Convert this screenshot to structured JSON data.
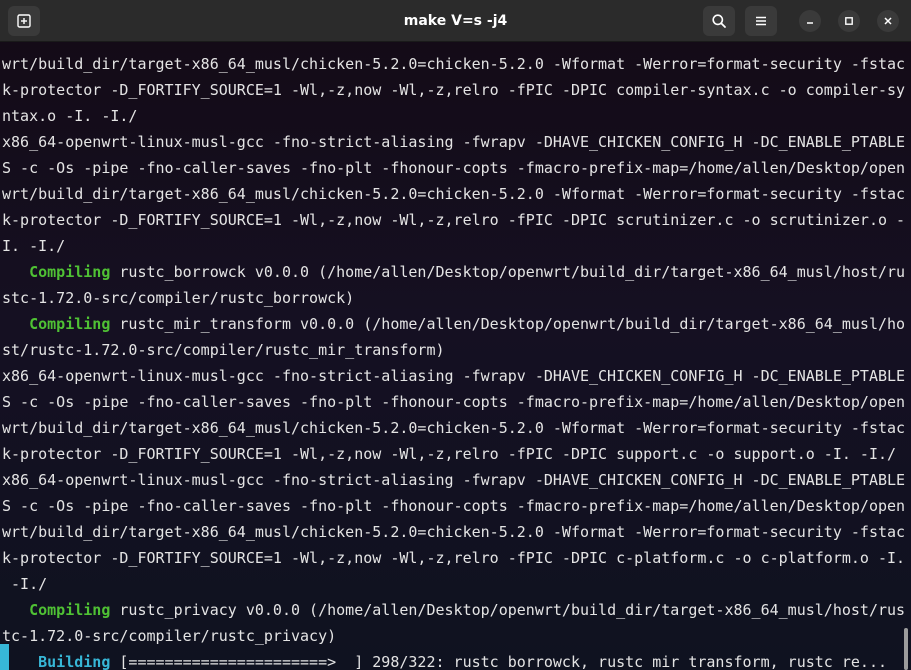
{
  "window": {
    "title": "make V=s -j4"
  },
  "icons": {
    "new_tab": "new-tab-icon",
    "search": "search-icon",
    "menu": "hamburger-menu-icon",
    "minimize": "minimize-icon",
    "maximize": "maximize-icon",
    "close": "close-icon"
  },
  "colors": {
    "compiling": "#4fc134",
    "building": "#37b7d7",
    "text": "#e4e4e4"
  },
  "terminal": {
    "lines": [
      {
        "kw": "",
        "text": "wrt/build_dir/target-x86_64_musl/chicken-5.2.0=chicken-5.2.0 -Wformat -Werror=format-security -fstac"
      },
      {
        "kw": "",
        "text": "k-protector -D_FORTIFY_SOURCE=1 -Wl,-z,now -Wl,-z,relro -fPIC -DPIC compiler-syntax.c -o compiler-sy"
      },
      {
        "kw": "",
        "text": "ntax.o -I. -I./"
      },
      {
        "kw": "",
        "text": "x86_64-openwrt-linux-musl-gcc -fno-strict-aliasing -fwrapv -DHAVE_CHICKEN_CONFIG_H -DC_ENABLE_PTABLE"
      },
      {
        "kw": "",
        "text": "S -c -Os -pipe -fno-caller-saves -fno-plt -fhonour-copts -fmacro-prefix-map=/home/allen/Desktop/open"
      },
      {
        "kw": "",
        "text": "wrt/build_dir/target-x86_64_musl/chicken-5.2.0=chicken-5.2.0 -Wformat -Werror=format-security -fstac"
      },
      {
        "kw": "",
        "text": "k-protector -D_FORTIFY_SOURCE=1 -Wl,-z,now -Wl,-z,relro -fPIC -DPIC scrutinizer.c -o scrutinizer.o -"
      },
      {
        "kw": "",
        "text": "I. -I./"
      },
      {
        "kw": "Compiling",
        "indent": "   ",
        "text": " rustc_borrowck v0.0.0 (/home/allen/Desktop/openwrt/build_dir/target-x86_64_musl/host/ru"
      },
      {
        "kw": "",
        "text": "stc-1.72.0-src/compiler/rustc_borrowck)"
      },
      {
        "kw": "Compiling",
        "indent": "   ",
        "text": " rustc_mir_transform v0.0.0 (/home/allen/Desktop/openwrt/build_dir/target-x86_64_musl/ho"
      },
      {
        "kw": "",
        "text": "st/rustc-1.72.0-src/compiler/rustc_mir_transform)"
      },
      {
        "kw": "",
        "text": "x86_64-openwrt-linux-musl-gcc -fno-strict-aliasing -fwrapv -DHAVE_CHICKEN_CONFIG_H -DC_ENABLE_PTABLE"
      },
      {
        "kw": "",
        "text": "S -c -Os -pipe -fno-caller-saves -fno-plt -fhonour-copts -fmacro-prefix-map=/home/allen/Desktop/open"
      },
      {
        "kw": "",
        "text": "wrt/build_dir/target-x86_64_musl/chicken-5.2.0=chicken-5.2.0 -Wformat -Werror=format-security -fstac"
      },
      {
        "kw": "",
        "text": "k-protector -D_FORTIFY_SOURCE=1 -Wl,-z,now -Wl,-z,relro -fPIC -DPIC support.c -o support.o -I. -I./"
      },
      {
        "kw": "",
        "text": "x86_64-openwrt-linux-musl-gcc -fno-strict-aliasing -fwrapv -DHAVE_CHICKEN_CONFIG_H -DC_ENABLE_PTABLE"
      },
      {
        "kw": "",
        "text": "S -c -Os -pipe -fno-caller-saves -fno-plt -fhonour-copts -fmacro-prefix-map=/home/allen/Desktop/open"
      },
      {
        "kw": "",
        "text": "wrt/build_dir/target-x86_64_musl/chicken-5.2.0=chicken-5.2.0 -Wformat -Werror=format-security -fstac"
      },
      {
        "kw": "",
        "text": "k-protector -D_FORTIFY_SOURCE=1 -Wl,-z,now -Wl,-z,relro -fPIC -DPIC c-platform.c -o c-platform.o -I."
      },
      {
        "kw": "",
        "text": " -I./"
      },
      {
        "kw": "Compiling",
        "indent": "   ",
        "text": " rustc_privacy v0.0.0 (/home/allen/Desktop/openwrt/build_dir/target-x86_64_musl/host/rus"
      },
      {
        "kw": "",
        "text": "tc-1.72.0-src/compiler/rustc_privacy)"
      },
      {
        "kw": "Building",
        "indent": "    ",
        "text": " [======================>  ] 298/322: rustc_borrowck, rustc_mir_transform, rustc_re..."
      }
    ]
  }
}
